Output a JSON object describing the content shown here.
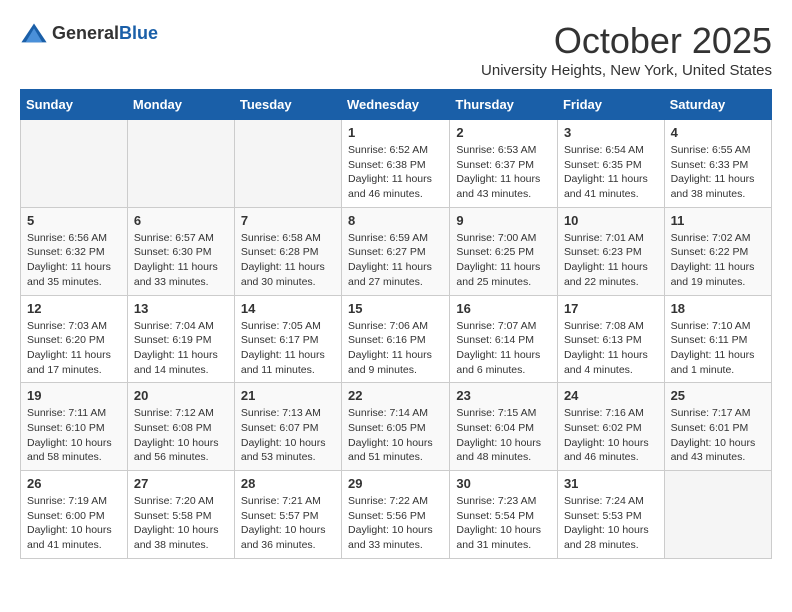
{
  "header": {
    "logo_general": "General",
    "logo_blue": "Blue",
    "month_title": "October 2025",
    "subtitle": "University Heights, New York, United States"
  },
  "days_of_week": [
    "Sunday",
    "Monday",
    "Tuesday",
    "Wednesday",
    "Thursday",
    "Friday",
    "Saturday"
  ],
  "weeks": [
    {
      "days": [
        {
          "number": "",
          "info": "",
          "empty": true
        },
        {
          "number": "",
          "info": "",
          "empty": true
        },
        {
          "number": "",
          "info": "",
          "empty": true
        },
        {
          "number": "1",
          "info": "Sunrise: 6:52 AM\nSunset: 6:38 PM\nDaylight: 11 hours and 46 minutes.",
          "empty": false
        },
        {
          "number": "2",
          "info": "Sunrise: 6:53 AM\nSunset: 6:37 PM\nDaylight: 11 hours and 43 minutes.",
          "empty": false
        },
        {
          "number": "3",
          "info": "Sunrise: 6:54 AM\nSunset: 6:35 PM\nDaylight: 11 hours and 41 minutes.",
          "empty": false
        },
        {
          "number": "4",
          "info": "Sunrise: 6:55 AM\nSunset: 6:33 PM\nDaylight: 11 hours and 38 minutes.",
          "empty": false
        }
      ]
    },
    {
      "days": [
        {
          "number": "5",
          "info": "Sunrise: 6:56 AM\nSunset: 6:32 PM\nDaylight: 11 hours and 35 minutes.",
          "empty": false
        },
        {
          "number": "6",
          "info": "Sunrise: 6:57 AM\nSunset: 6:30 PM\nDaylight: 11 hours and 33 minutes.",
          "empty": false
        },
        {
          "number": "7",
          "info": "Sunrise: 6:58 AM\nSunset: 6:28 PM\nDaylight: 11 hours and 30 minutes.",
          "empty": false
        },
        {
          "number": "8",
          "info": "Sunrise: 6:59 AM\nSunset: 6:27 PM\nDaylight: 11 hours and 27 minutes.",
          "empty": false
        },
        {
          "number": "9",
          "info": "Sunrise: 7:00 AM\nSunset: 6:25 PM\nDaylight: 11 hours and 25 minutes.",
          "empty": false
        },
        {
          "number": "10",
          "info": "Sunrise: 7:01 AM\nSunset: 6:23 PM\nDaylight: 11 hours and 22 minutes.",
          "empty": false
        },
        {
          "number": "11",
          "info": "Sunrise: 7:02 AM\nSunset: 6:22 PM\nDaylight: 11 hours and 19 minutes.",
          "empty": false
        }
      ]
    },
    {
      "days": [
        {
          "number": "12",
          "info": "Sunrise: 7:03 AM\nSunset: 6:20 PM\nDaylight: 11 hours and 17 minutes.",
          "empty": false
        },
        {
          "number": "13",
          "info": "Sunrise: 7:04 AM\nSunset: 6:19 PM\nDaylight: 11 hours and 14 minutes.",
          "empty": false
        },
        {
          "number": "14",
          "info": "Sunrise: 7:05 AM\nSunset: 6:17 PM\nDaylight: 11 hours and 11 minutes.",
          "empty": false
        },
        {
          "number": "15",
          "info": "Sunrise: 7:06 AM\nSunset: 6:16 PM\nDaylight: 11 hours and 9 minutes.",
          "empty": false
        },
        {
          "number": "16",
          "info": "Sunrise: 7:07 AM\nSunset: 6:14 PM\nDaylight: 11 hours and 6 minutes.",
          "empty": false
        },
        {
          "number": "17",
          "info": "Sunrise: 7:08 AM\nSunset: 6:13 PM\nDaylight: 11 hours and 4 minutes.",
          "empty": false
        },
        {
          "number": "18",
          "info": "Sunrise: 7:10 AM\nSunset: 6:11 PM\nDaylight: 11 hours and 1 minute.",
          "empty": false
        }
      ]
    },
    {
      "days": [
        {
          "number": "19",
          "info": "Sunrise: 7:11 AM\nSunset: 6:10 PM\nDaylight: 10 hours and 58 minutes.",
          "empty": false
        },
        {
          "number": "20",
          "info": "Sunrise: 7:12 AM\nSunset: 6:08 PM\nDaylight: 10 hours and 56 minutes.",
          "empty": false
        },
        {
          "number": "21",
          "info": "Sunrise: 7:13 AM\nSunset: 6:07 PM\nDaylight: 10 hours and 53 minutes.",
          "empty": false
        },
        {
          "number": "22",
          "info": "Sunrise: 7:14 AM\nSunset: 6:05 PM\nDaylight: 10 hours and 51 minutes.",
          "empty": false
        },
        {
          "number": "23",
          "info": "Sunrise: 7:15 AM\nSunset: 6:04 PM\nDaylight: 10 hours and 48 minutes.",
          "empty": false
        },
        {
          "number": "24",
          "info": "Sunrise: 7:16 AM\nSunset: 6:02 PM\nDaylight: 10 hours and 46 minutes.",
          "empty": false
        },
        {
          "number": "25",
          "info": "Sunrise: 7:17 AM\nSunset: 6:01 PM\nDaylight: 10 hours and 43 minutes.",
          "empty": false
        }
      ]
    },
    {
      "days": [
        {
          "number": "26",
          "info": "Sunrise: 7:19 AM\nSunset: 6:00 PM\nDaylight: 10 hours and 41 minutes.",
          "empty": false
        },
        {
          "number": "27",
          "info": "Sunrise: 7:20 AM\nSunset: 5:58 PM\nDaylight: 10 hours and 38 minutes.",
          "empty": false
        },
        {
          "number": "28",
          "info": "Sunrise: 7:21 AM\nSunset: 5:57 PM\nDaylight: 10 hours and 36 minutes.",
          "empty": false
        },
        {
          "number": "29",
          "info": "Sunrise: 7:22 AM\nSunset: 5:56 PM\nDaylight: 10 hours and 33 minutes.",
          "empty": false
        },
        {
          "number": "30",
          "info": "Sunrise: 7:23 AM\nSunset: 5:54 PM\nDaylight: 10 hours and 31 minutes.",
          "empty": false
        },
        {
          "number": "31",
          "info": "Sunrise: 7:24 AM\nSunset: 5:53 PM\nDaylight: 10 hours and 28 minutes.",
          "empty": false
        },
        {
          "number": "",
          "info": "",
          "empty": true
        }
      ]
    }
  ]
}
